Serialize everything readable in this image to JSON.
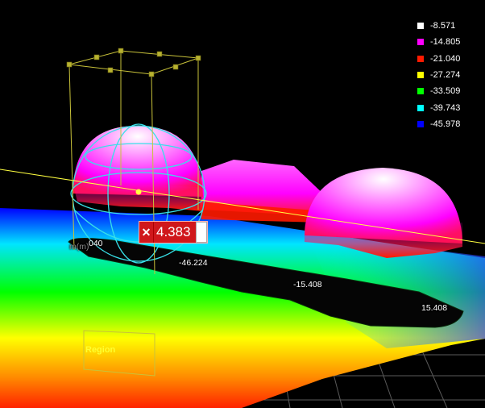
{
  "legend": {
    "items": [
      {
        "label": "-8.571",
        "color": "#ffffff"
      },
      {
        "label": "-14.805",
        "color": "#ff00ff"
      },
      {
        "label": "-21.040",
        "color": "#ff1a00"
      },
      {
        "label": "-27.274",
        "color": "#ffff00"
      },
      {
        "label": "-33.509",
        "color": "#00ff00"
      },
      {
        "label": "-39.743",
        "color": "#00ffff"
      },
      {
        "label": "-45.978",
        "color": "#0000ff"
      }
    ]
  },
  "measurement": {
    "close_symbol": "✕",
    "value": "4.383"
  },
  "region": {
    "label": "Region"
  },
  "axis": {
    "unit_label": "m(m)",
    "tick_040": "040",
    "tick_a": "-46.224",
    "tick_b": "-15.408",
    "tick_c": "15.408"
  },
  "colors": {
    "grid": "#5a5a5a",
    "bounding_box": "#c8c23a",
    "sphere_wire": "#38e0e8",
    "reference_line": "#ffff40"
  }
}
